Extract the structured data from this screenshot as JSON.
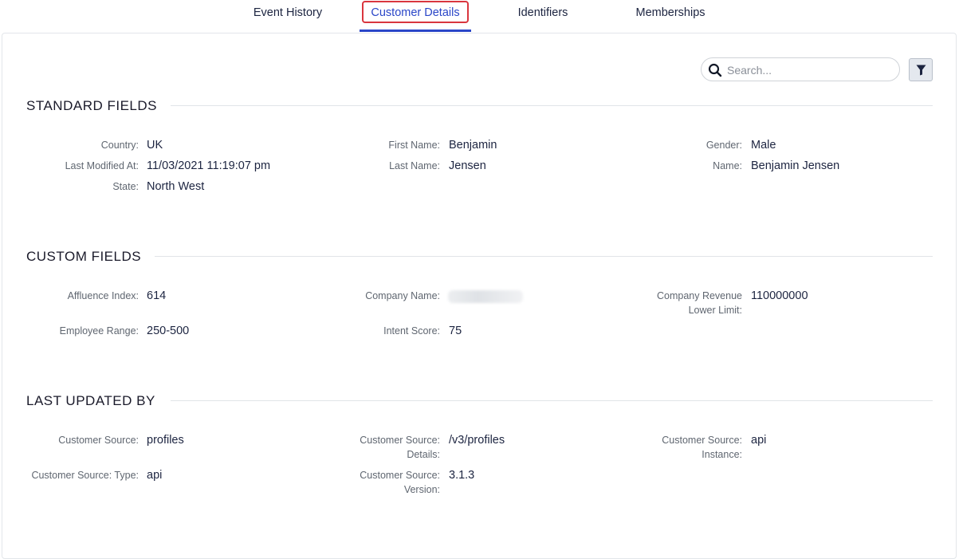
{
  "tabs": [
    {
      "label": "Event History"
    },
    {
      "label": "Customer Details"
    },
    {
      "label": "Identifiers"
    },
    {
      "label": "Memberships"
    }
  ],
  "search": {
    "placeholder": "Search..."
  },
  "sections": {
    "standard": {
      "title": "STANDARD FIELDS",
      "fields": {
        "country": {
          "label": "Country:",
          "value": "UK"
        },
        "last_modified": {
          "label": "Last Modified At:",
          "value": "11/03/2021 11:19:07 pm"
        },
        "state": {
          "label": "State:",
          "value": "North West"
        },
        "first_name": {
          "label": "First Name:",
          "value": "Benjamin"
        },
        "last_name": {
          "label": "Last Name:",
          "value": "Jensen"
        },
        "gender": {
          "label": "Gender:",
          "value": "Male"
        },
        "name": {
          "label": "Name:",
          "value": "Benjamin Jensen"
        }
      }
    },
    "custom": {
      "title": "CUSTOM FIELDS",
      "fields": {
        "affluence": {
          "label": "Affluence Index:",
          "value": "614"
        },
        "employee_range": {
          "label": "Employee Range:",
          "value": "250-500"
        },
        "company_name": {
          "label": "Company Name:"
        },
        "intent_score": {
          "label": "Intent Score:",
          "value": "75"
        },
        "company_revenue": {
          "label_line1": "Company Revenue",
          "label_line2": "Lower Limit:",
          "value": "110000000"
        }
      }
    },
    "last_updated": {
      "title": "LAST UPDATED BY",
      "fields": {
        "source": {
          "label": "Customer Source:",
          "value": "profiles"
        },
        "source_type": {
          "label": "Customer Source: Type:",
          "value": "api"
        },
        "source_details": {
          "label_line1": "Customer Source:",
          "label_line2": "Details:",
          "value": "/v3/profiles"
        },
        "source_version": {
          "label_line1": "Customer Source:",
          "label_line2": "Version:",
          "value": "3.1.3"
        },
        "source_instance": {
          "label_line1": "Customer Source:",
          "label_line2": "Instance:",
          "value": "api"
        }
      }
    }
  },
  "colors": {
    "accent": "#2a46c8",
    "highlight": "#d9363e"
  },
  "icons": {
    "search": "search-icon",
    "filter": "filter-icon"
  }
}
